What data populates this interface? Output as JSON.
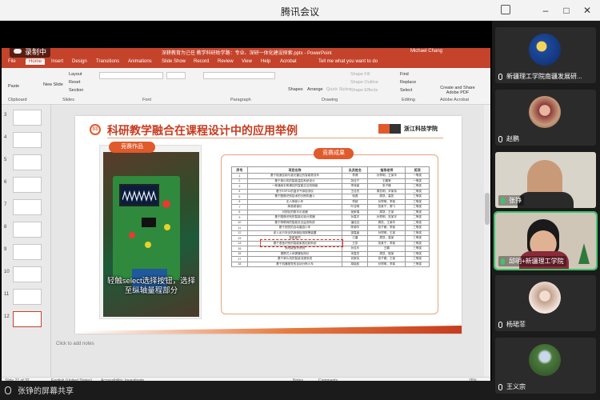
{
  "window": {
    "title": "腾讯会议",
    "controls": [
      "–",
      "□",
      "✕"
    ]
  },
  "recording": {
    "label": "录制中"
  },
  "share_bar": {
    "label": "张铮的屏幕共享"
  },
  "ppt": {
    "filename": "深耕教育为己任 教学科研助学路：专业、深研一体化建设探索.pptx - PowerPoint",
    "user": "Michael Chang",
    "search_hint": "Tell me what you want to do",
    "tabs": [
      "File",
      "Home",
      "Insert",
      "Design",
      "Transitions",
      "Animations",
      "Slide Show",
      "Record",
      "Review",
      "View",
      "Help",
      "Acrobat"
    ],
    "active_tab": "Home",
    "ribbon_groups": [
      "Clipboard",
      "Slides",
      "Font",
      "Paragraph",
      "Drawing",
      "Editing",
      "Adobe Acrobat"
    ],
    "ribbon_buttons": {
      "paste": "Paste",
      "new_slide": "New Slide",
      "layout": "Layout",
      "reset": "Reset",
      "section": "Section",
      "shapes": "Shapes",
      "arrange": "Arrange",
      "quick_styles": "Quick Styles",
      "shape_fill": "Shape Fill",
      "shape_outline": "Shape Outline",
      "shape_effects": "Shape Effects",
      "find": "Find",
      "replace": "Replace",
      "select": "Select",
      "create_share": "Create and Share Adobe PDF"
    },
    "thumbnail_numbers": [
      "3",
      "4",
      "5",
      "6",
      "7",
      "8",
      "9",
      "10",
      "11",
      "12"
    ],
    "notes_placeholder": "Click to add notes",
    "status": {
      "slide": "Slide 27 of 32",
      "language": "English (United States)",
      "accessibility": "Accessibility: Investigate",
      "notes": "Notes",
      "comments": "Comments",
      "zoom": "76%"
    }
  },
  "slide": {
    "number": "03",
    "title": "科研教学融合在课程设计中的应用举例",
    "logo_text": "浙江科技学院",
    "photo_tag": "竞赛作品",
    "photo_caption": "轻触select选择按钮，选择至纵轴量程部分",
    "result_tag": "竞赛成果",
    "table_headers": [
      "序号",
      "项目名称",
      "队员姓名",
      "指导老师",
      "奖项"
    ],
    "table_rows": [
      [
        "1",
        "基于极速控制与激光雷达的智能物流车",
        "李健",
        "孙郑明，王某华",
        "一等奖"
      ],
      [
        "2",
        "基于单片机的智能温控系统设计",
        "张佳宁",
        "王鹏等",
        "一等奖"
      ],
      [
        "3",
        "一种通用手势操控的智能交互机械臂",
        "李泽豪",
        "张子峰",
        "二等奖"
      ],
      [
        "4",
        "基于ESP32的蓝牙气体检测仪",
        "王佳杰",
        "周凯明，尹某伟",
        "二等奖"
      ],
      [
        "5",
        "基于图像识别技术的分拣机器人",
        "徐昌",
        "周凯，高凯",
        "三等奖"
      ],
      [
        "6",
        "无人驾驶小车",
        "李超",
        "孙郑明，李某",
        "三等奖"
      ],
      [
        "7",
        "简易频谱仪",
        "叶佳明",
        "张某宁，周飞",
        "三等奖"
      ],
      [
        "8",
        "可视化的数字示波器",
        "吴家瑞",
        "周凯，王某",
        "二等奖"
      ],
      [
        "9",
        "基于图像识别的智能垃圾分类器",
        "孙嘉宇",
        "孙郑明，张某宇",
        "二等奖"
      ],
      [
        "10",
        "基于物联网的智能农业监测系统",
        "潘佳钰",
        "周凯，王某华",
        "二等奖"
      ],
      [
        "11",
        "基于视觉的自动循迹小车",
        "陈锦华",
        "张子峰，李某",
        "三等奖"
      ],
      [
        "12",
        "老人出行安全防摔倒检测报警装置",
        "邵嘉鑫",
        "孙郑明，王某",
        "三等奖"
      ],
      [
        "13",
        "智能窗帘",
        "江晨",
        "周凯，高某",
        "三等奖"
      ],
      [
        "14",
        "基于语音识别的智能家居控制系统",
        "王凯",
        "张某宁，李某",
        "三等奖"
      ],
      [
        "15",
        "太阳能追光系统",
        "孙佳乐",
        "王鹏",
        "三等奖"
      ],
      [
        "16",
        "便携式人体健康检测仪",
        "宋嘉杰",
        "周凯，程某",
        "三等奖"
      ],
      [
        "17",
        "基于单片机的智能浇灌系统",
        "何家炜",
        "张子峰，王某",
        "三等奖"
      ],
      [
        "18",
        "基于机器视觉的自动分拣小车",
        "胡晓航",
        "孙郑明，李某",
        "三等奖"
      ]
    ]
  },
  "participants": [
    {
      "name": "新疆理工学院南疆发展研...",
      "type": "avatar",
      "mic": "muted"
    },
    {
      "name": "赵鹏",
      "type": "avatar",
      "mic": "muted"
    },
    {
      "name": "张铮",
      "type": "video",
      "mic": "on"
    },
    {
      "name": "邱明+新疆理工学院",
      "type": "video",
      "mic": "on"
    },
    {
      "name": "杨珺菲",
      "type": "avatar",
      "mic": "muted"
    },
    {
      "name": "王义宗",
      "type": "avatar",
      "mic": "muted"
    }
  ],
  "colors": {
    "ppt_accent": "#c4432a",
    "slide_accent": "#e05a2b",
    "active_speaker": "#3cc46a"
  }
}
